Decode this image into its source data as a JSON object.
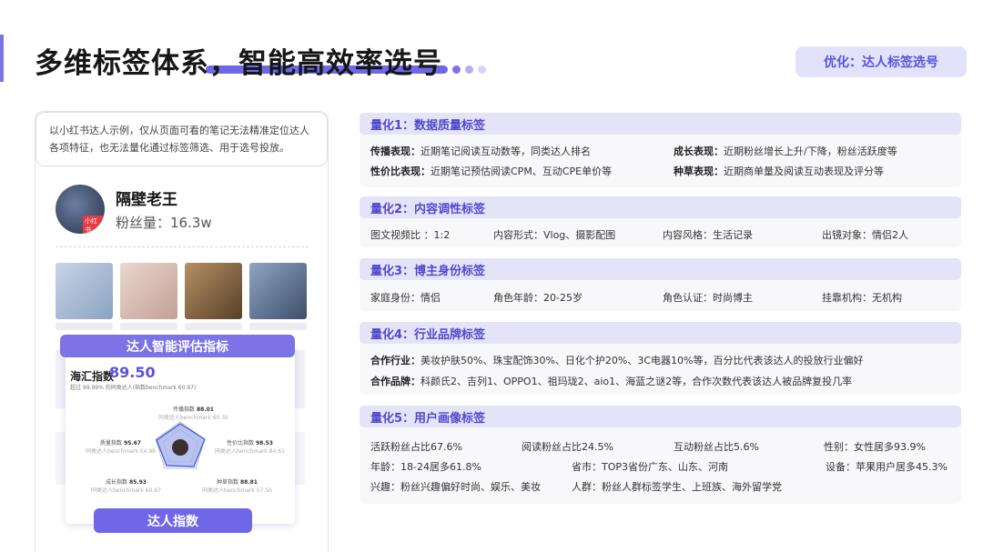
{
  "title": "多维标签体系，智能高效率选号",
  "badge": "优化：达人标签选号",
  "left": {
    "intro": "以小红书达人示例，仅从页面可看的笔记无法精准定位达人各项特征，也无法量化通过标签筛选、用于选号投放。",
    "avatar_tag": "小红书",
    "name": "隔壁老王",
    "fans": "粉丝量：16.3w",
    "eval_header": "达人智能评估指标",
    "index_label": "海汇指数",
    "index_score": "89.50",
    "index_sub": "超过 99.99% 的同类达人(指数benchmark 60.97)",
    "metrics": {
      "spread": {
        "label": "传播指数",
        "value": "88.01",
        "bench": "同类达人benchmark 60.35"
      },
      "quality": {
        "label": "质量指数",
        "value": "95.67",
        "bench": "同类达人benchmark 54.98"
      },
      "value_ratio": {
        "label": "性价比指数",
        "value": "98.53",
        "bench": "同类达人benchmark 84.61"
      },
      "growth": {
        "label": "成长指数",
        "value": "85.93",
        "bench": "同类达人benchmark 60.67"
      },
      "seeding": {
        "label": "种草指数",
        "value": "88.81",
        "bench": "同类达人benchmark 57.50"
      }
    },
    "expert_btn": "达人指数"
  },
  "sections": {
    "s1": {
      "title": "量化1：数据质量标签",
      "r1a_k": "传播表现：",
      "r1a_v": "近期笔记阅读互动数等，同类达人排名",
      "r1b_k": "成长表现：",
      "r1b_v": "近期粉丝增长上升/下降，粉丝活跃度等",
      "r2a_k": "性价比表现：",
      "r2a_v": "近期笔记预估阅读CPM、互动CPE单价等",
      "r2b_k": "种草表现：",
      "r2b_v": "近期商单量及阅读互动表现及评分等"
    },
    "s2": {
      "title": "量化2：内容调性标签",
      "a": "图文视频比 ：1:2",
      "b": "内容形式：Vlog、摄影配图",
      "c": "内容风格：生活记录",
      "d": "出镜对象：情侣2人"
    },
    "s3": {
      "title": "量化3：博主身份标签",
      "a": "家庭身份：情侣",
      "b": "角色年龄：20-25岁",
      "c": "角色认证：时尚博主",
      "d": "挂靠机构：无机构"
    },
    "s4": {
      "title": "量化4：行业品牌标签",
      "r1_k": "合作行业：",
      "r1_v": "美妆护肤50%、珠宝配饰30%、日化个护20%、3C电器10%等，百分比代表该达人的投放行业偏好",
      "r2_k": "合作品牌：",
      "r2_v": "科颜氏2、吉列1、OPPO1、祖玛珑2、aio1、海蓝之谜2等，合作次数代表该达人被品牌复投几率"
    },
    "s5": {
      "title": "量化5：用户画像标签",
      "a1": "活跃粉丝占比67.6%",
      "a2": "阅读粉丝占比24.5%",
      "a3": "互动粉丝占比5.6%",
      "a4": "性别：女性居多93.9%",
      "b1": "年龄：18-24居多61.8%",
      "b2": "省市：TOP3省份广东、山东、河南",
      "b3": "设备：苹果用户居多45.3%",
      "c1": "兴趣：粉丝兴趣偏好时尚、娱乐、美妆",
      "c2": "人群：粉丝人群标签学生、上班族、海外留学党"
    }
  },
  "colors": {
    "accent": "#7b73e6",
    "section_head": "#e4e3f8",
    "section_text": "#5048cf"
  }
}
